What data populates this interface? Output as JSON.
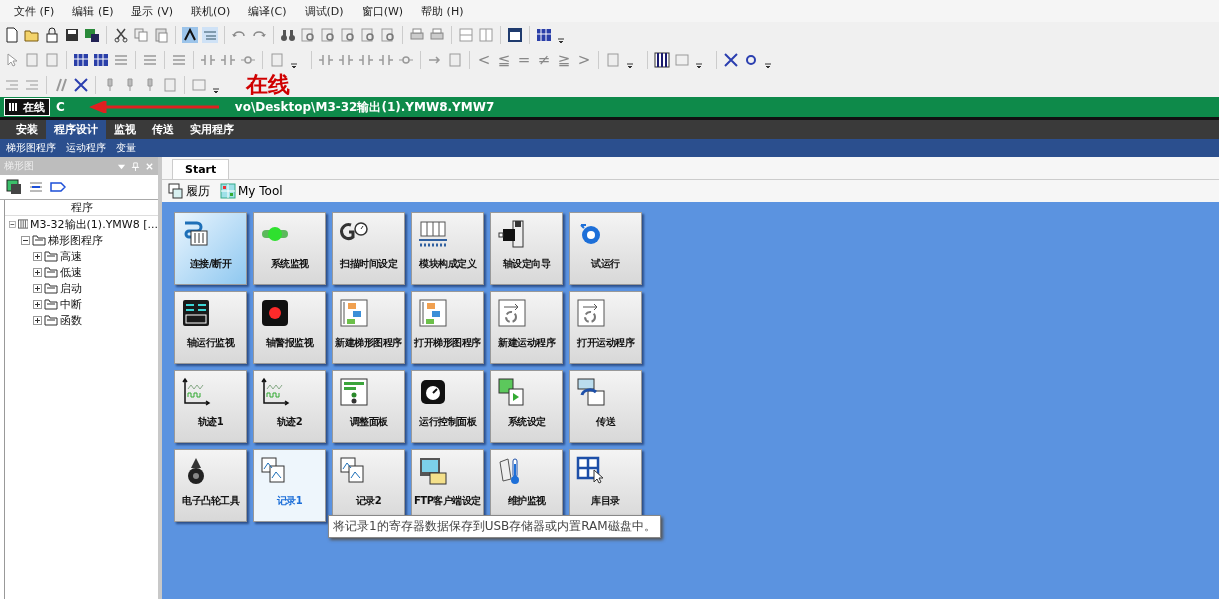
{
  "menu": [
    "文件 (F)",
    "编辑 (E)",
    "显示 (V)",
    "联机(O)",
    "编译(C)",
    "调试(D)",
    "窗口(W)",
    "帮助 (H)"
  ],
  "toolbar_symbols": [
    "<",
    "≦",
    "=",
    "≠",
    "≧",
    ">"
  ],
  "status": {
    "mode": "在线",
    "title_start": "C",
    "title_end": "vo\\Desktop\\M3-32输出(1).YMW8.YMW7"
  },
  "annotation": {
    "text": "在线"
  },
  "nav_tabs": [
    {
      "label": "安装",
      "selected": false
    },
    {
      "label": "程序设计",
      "selected": true
    },
    {
      "label": "监视",
      "selected": false
    },
    {
      "label": "传送",
      "selected": false
    },
    {
      "label": "实用程序",
      "selected": false
    }
  ],
  "sub_nav": [
    "梯形图程序",
    "运动程序",
    "变量"
  ],
  "side_panel": {
    "title": "梯形图",
    "column": "程序",
    "tree": [
      {
        "label": "M3-32输出(1).YMW8 [...",
        "expanded": true,
        "children": [
          {
            "label": "梯形图程序",
            "expanded": true,
            "children": [
              {
                "label": "高速",
                "expanded": false
              },
              {
                "label": "低速",
                "expanded": false
              },
              {
                "label": "启动",
                "expanded": false
              },
              {
                "label": "中断",
                "expanded": false
              },
              {
                "label": "函数",
                "expanded": false
              }
            ]
          }
        ]
      }
    ]
  },
  "doc_tabs": [
    {
      "label": "Start",
      "selected": true
    }
  ],
  "start_toolbar": [
    "履历",
    "My Tool"
  ],
  "tiles": [
    {
      "label": "连接/断开",
      "selected": true,
      "hovered": false
    },
    {
      "label": "系统监视",
      "selected": false,
      "hovered": false
    },
    {
      "label": "扫描时间设定",
      "selected": false,
      "hovered": false
    },
    {
      "label": "模块构成定义",
      "selected": false,
      "hovered": false
    },
    {
      "label": "轴设定向导",
      "selected": false,
      "hovered": false
    },
    {
      "label": "试运行",
      "selected": false,
      "hovered": false
    },
    {
      "label": "轴运行监视",
      "selected": false,
      "hovered": false
    },
    {
      "label": "轴警报监视",
      "selected": false,
      "hovered": false
    },
    {
      "label": "新建梯形图程序",
      "selected": false,
      "hovered": false
    },
    {
      "label": "打开梯形图程序",
      "selected": false,
      "hovered": false
    },
    {
      "label": "新建运动程序",
      "selected": false,
      "hovered": false
    },
    {
      "label": "打开运动程序",
      "selected": false,
      "hovered": false
    },
    {
      "label": "轨迹1",
      "selected": false,
      "hovered": false
    },
    {
      "label": "轨迹2",
      "selected": false,
      "hovered": false
    },
    {
      "label": "调整面板",
      "selected": false,
      "hovered": false
    },
    {
      "label": "运行控制面板",
      "selected": false,
      "hovered": false
    },
    {
      "label": "系统设定",
      "selected": false,
      "hovered": false
    },
    {
      "label": "传送",
      "selected": false,
      "hovered": false
    },
    {
      "label": "电子凸轮工具",
      "selected": false,
      "hovered": false
    },
    {
      "label": "记录1",
      "selected": false,
      "hovered": true
    },
    {
      "label": "记录2",
      "selected": false,
      "hovered": false
    },
    {
      "label": "FTP客户端设定",
      "selected": false,
      "hovered": false
    },
    {
      "label": "维护监视",
      "selected": false,
      "hovered": false
    },
    {
      "label": "库目录",
      "selected": false,
      "hovered": false
    }
  ],
  "tooltip": "将记录1的寄存器数据保存到USB存储器或内置RAM磁盘中。"
}
